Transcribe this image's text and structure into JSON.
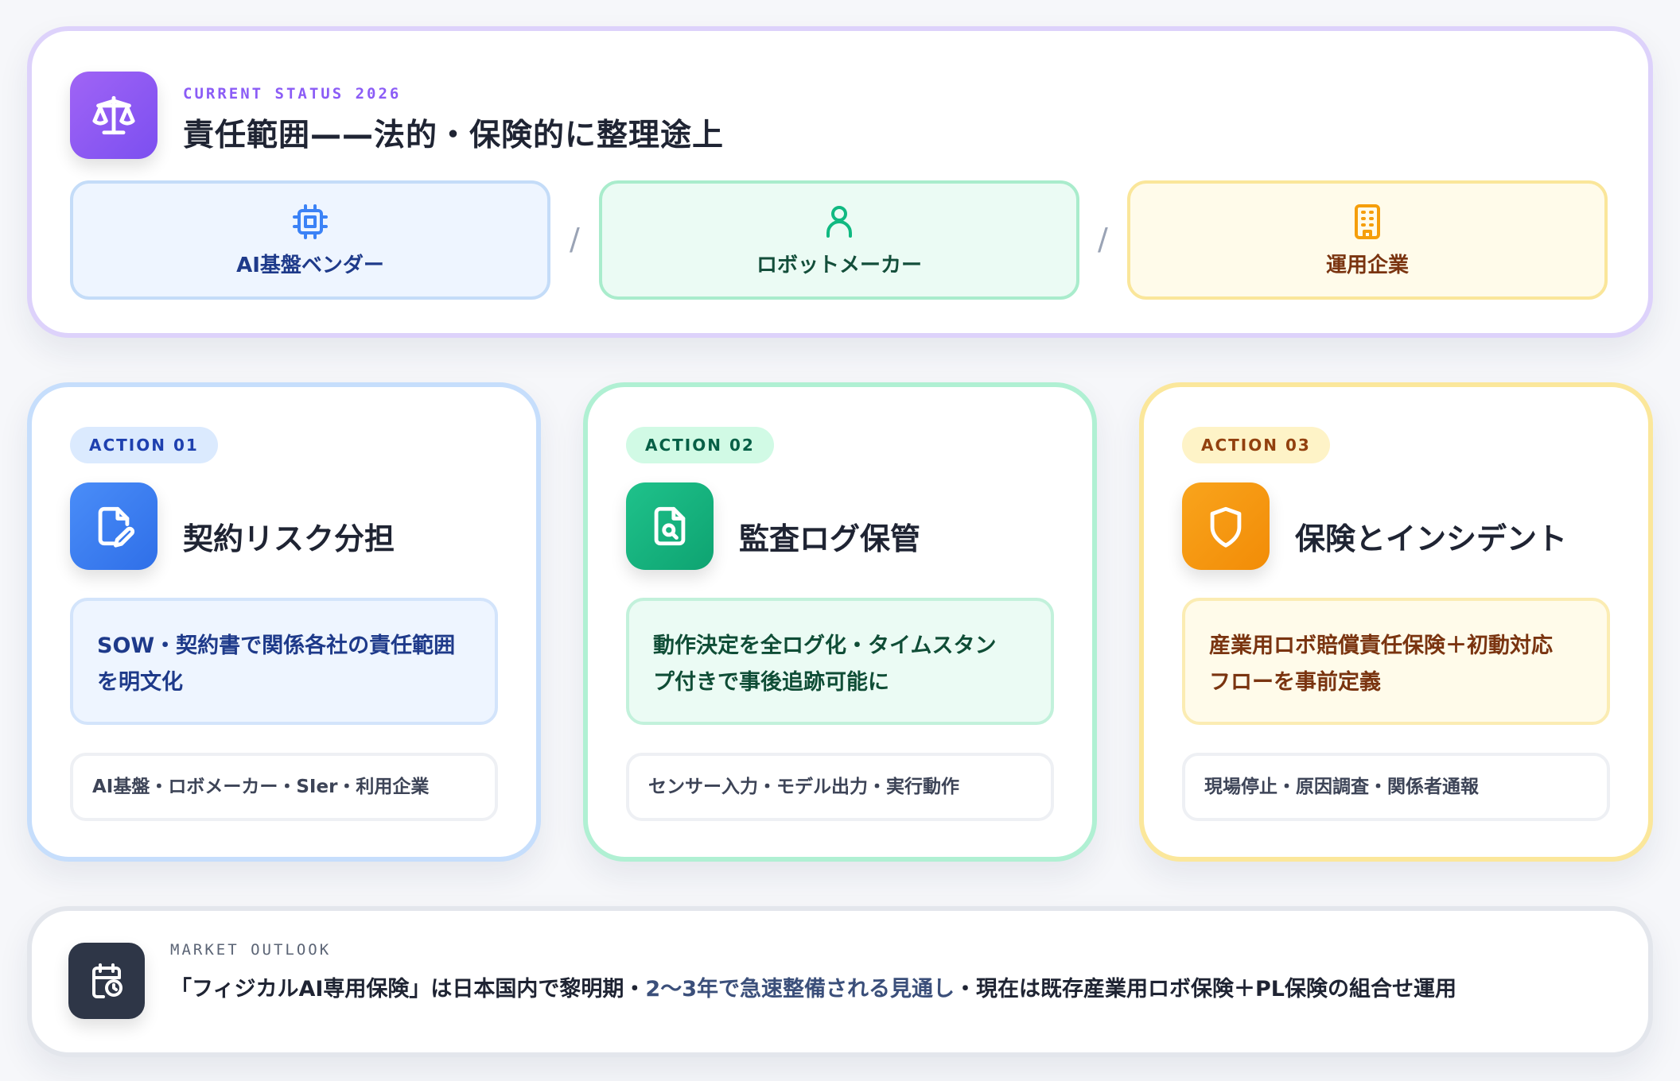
{
  "status": {
    "eyebrow": "CURRENT STATUS 2026",
    "title": "責任範囲——法的・保険的に整理途上",
    "icon": "scale-icon",
    "parties": [
      {
        "label": "AI基盤ベンダー",
        "icon": "chip-icon",
        "color": "#3b82f6"
      },
      {
        "label": "ロボットメーカー",
        "icon": "user-icon",
        "color": "#10b981"
      },
      {
        "label": "運用企業",
        "icon": "building-icon",
        "color": "#f59e0b"
      }
    ],
    "separator": "/"
  },
  "actions": [
    {
      "tag": "ACTION 01",
      "title": "契約リスク分担",
      "icon": "document-edit-icon",
      "description": [
        "SOW・契約書で関係各社の責任範囲",
        "を明文化"
      ],
      "detail": "AI基盤・ロボメーカー・SIer・利用企業",
      "color": "#3b82f6"
    },
    {
      "tag": "ACTION 02",
      "title": "監査ログ保管",
      "icon": "file-search-icon",
      "description": [
        "動作決定を全ログ化・タイムスタン",
        "プ付きで事後追跡可能に"
      ],
      "detail": "センサー入力・モデル出力・実行動作",
      "color": "#10b981"
    },
    {
      "tag": "ACTION 03",
      "title": "保険とインシデント",
      "icon": "shield-icon",
      "description": [
        "産業用ロボ賠償責任保険＋初動対応",
        "フローを事前定義"
      ],
      "detail": "現場停止・原因調査・関係者通報",
      "color": "#f59e0b"
    }
  ],
  "outlook": {
    "eyebrow": "MARKET OUTLOOK",
    "icon": "calendar-clock-icon",
    "text_before": "「フィジカルAI専用保険」は日本国内で黎明期・",
    "text_highlight": "2〜3年で急速整備される見通し",
    "text_after": "・現在は既存産業用ロボ保険＋PL保険の組合せ運用"
  }
}
